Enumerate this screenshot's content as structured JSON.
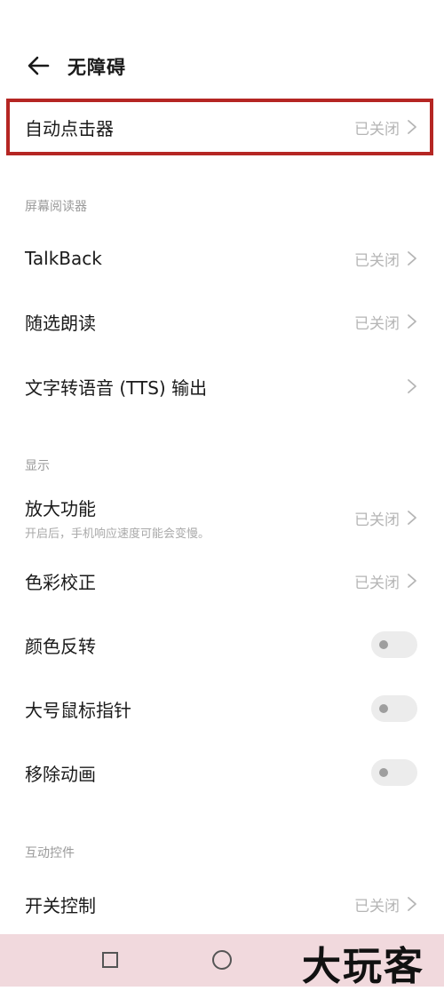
{
  "header": {
    "title": "无障碍"
  },
  "auto_clicker": {
    "label": "自动点击器",
    "status": "已关闭"
  },
  "sections": {
    "screen_reader": "屏幕阅读器",
    "display": "显示",
    "interaction": "互动控件"
  },
  "screen_reader_items": [
    {
      "label": "TalkBack",
      "status": "已关闭"
    },
    {
      "label": "随选朗读",
      "status": "已关闭"
    },
    {
      "label": "文字转语音 (TTS) 输出",
      "status": ""
    }
  ],
  "display_items": {
    "magnify": {
      "label": "放大功能",
      "sub": "开启后，手机响应速度可能会变慢。",
      "status": "已关闭"
    },
    "color_correction": {
      "label": "色彩校正",
      "status": "已关闭"
    },
    "color_invert": {
      "label": "颜色反转"
    },
    "large_pointer": {
      "label": "大号鼠标指针"
    },
    "remove_anim": {
      "label": "移除动画"
    }
  },
  "interaction_items": [
    {
      "label": "开关控制",
      "status": "已关闭"
    }
  ],
  "watermark": "大玩客",
  "colors": {
    "highlight": "#b52623",
    "navbar": "#f1d9dd"
  }
}
